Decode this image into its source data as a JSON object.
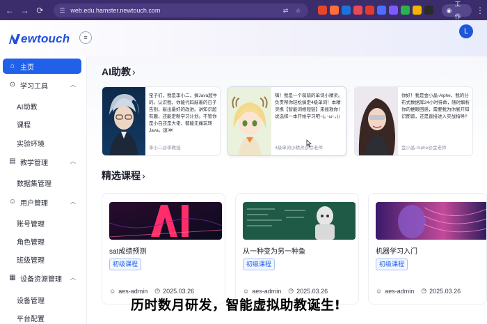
{
  "browser": {
    "url": "web.edu.hamster.newtouch.com",
    "work_label": "工作",
    "ext_colors": [
      "#e8462b",
      "#ff6d3a",
      "#1f73d8",
      "#e84b55",
      "#e23b2e",
      "#4c6fff",
      "#7c5cff",
      "#2bb24c",
      "#f5b400",
      "#2a2a2a"
    ]
  },
  "header": {
    "logo_text": "ewtouch",
    "avatar_letter": "L",
    "brand_color": "#1e4fd8"
  },
  "sidebar": {
    "home": "主页",
    "learning_tools": "学习工具",
    "ai_tutor": "AI助教",
    "course": "课程",
    "lab": "实验环境",
    "teaching_mgmt": "教学管理",
    "dataset_mgmt": "数据集管理",
    "user_mgmt": "用户管理",
    "account_mgmt": "账号管理",
    "role_mgmt": "角色管理",
    "class_mgmt": "班级管理",
    "device_resource_mgmt": "设备资源管理",
    "device_mgmt": "设备管理",
    "platform_config": "平台配置"
  },
  "main": {
    "ai_section_title": "AI助教",
    "ai_cards": [
      {
        "text": "宝子们，我是李小二，搞Java超牛的。认识我，你能代码敲着的日子告别，敲出最好的改进。讲知识超有趣，还能定制学习计划。不管你是小白还是大佬，都能无痛玩转 Java。速冲!",
        "sig": "李小二@李教授"
      },
      {
        "text": "嗨！我是一个萌萌的单词小精灵。负责帮你轻松搞定4级单词！本精灵携【智能词根短链】来拯救你！说选择一本开始学习吧~(｡･ω･｡)ﾉ",
        "sig": "4级单词小精灵@徐老师"
      },
      {
        "text": "你好！我是金小晶-Alphe，我的分布式数据库24小时待命，随时解析你的梗眼困惑，需要我为你展开知识图谱，还是直接进入实战指导?",
        "sig": "金小晶-Alphe@金老师"
      }
    ],
    "courses_section_title": "精选课程",
    "courses": [
      {
        "title": "sat成绩预测",
        "tag": "初级课程",
        "author": "aes-admin",
        "date": "2025.03.26"
      },
      {
        "title": "从一种变为另一种鱼",
        "tag": "初级课程",
        "author": "aes-admin",
        "date": "2025.03.26"
      },
      {
        "title": "机器学习入门",
        "tag": "初级课程",
        "author": "aes-admin",
        "date": "2025.03.26"
      }
    ]
  },
  "subtitle": "历时数月研发，智能虚拟助教诞生!"
}
